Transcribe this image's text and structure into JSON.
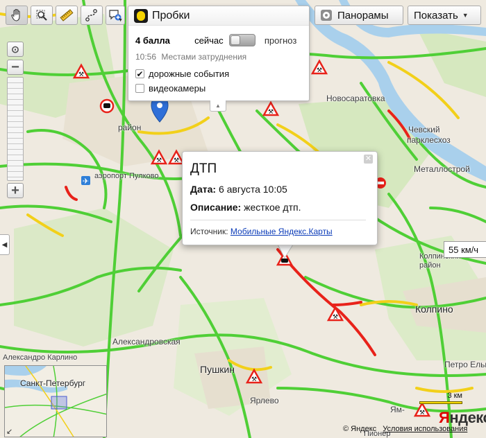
{
  "toolbar": {
    "tools": [
      {
        "name": "pan-tool",
        "icon": "hand-icon",
        "active": true
      },
      {
        "name": "magnifier-tool",
        "icon": "magnifier-icon",
        "active": false
      },
      {
        "name": "ruler-tool",
        "icon": "ruler-icon",
        "active": false
      },
      {
        "name": "route-tool",
        "icon": "route-icon",
        "active": false
      },
      {
        "name": "feedback-tool",
        "icon": "speech-plus-icon",
        "active": false
      }
    ],
    "panoramas_label": "Панорамы",
    "show_label": "Показать"
  },
  "traffic": {
    "title": "Пробки",
    "score": "4 балла",
    "now_label": "сейчас",
    "forecast_label": "прогноз",
    "time": "10:56",
    "status": "Местами затруднения",
    "road_events_label": "дорожные события",
    "road_events_checked": true,
    "cameras_label": "видеокамеры",
    "cameras_checked": false
  },
  "popup": {
    "title": "ДТП",
    "date_label": "Дата:",
    "date_value": "6 августа 10:05",
    "desc_label": "Описание:",
    "desc_value": "жесткое дтп.",
    "source_label": "Источник:",
    "source_link": "Мобильные Яндекс.Карты"
  },
  "speed": "55 км/ч",
  "scale_label": "3 км",
  "logo": {
    "first": "Я",
    "rest": "ндекс"
  },
  "copyright": "© Яндекс",
  "terms": "Условия использования",
  "minimap": {
    "city": "Санкт-Петербург"
  },
  "map_labels": {
    "novosaratovka": "Новосаратовка",
    "chevsky": "Чевский",
    "parklesxoz": "парклесхоз",
    "metallostroy": "Металлострой",
    "aeroport": "аэропорт Пулково",
    "rayon": "район",
    "aleksandrovskaya": "Александровская",
    "pushkin": "Пушкин",
    "kolpino": "Колпино",
    "kolpinsky": "Колпинский",
    "rayon2": "район",
    "karlino": "Александро Карлино",
    "selo": "Петро Ельман",
    "yarlevo": "Ярлево",
    "ym": "Ям-",
    "pionerskiy": "Пионер"
  },
  "colors": {
    "road_green": "#4fcf36",
    "road_yellow": "#f2d01a",
    "road_red": "#e8221a",
    "water": "#a9d0ec",
    "map_bg": "#efeae0",
    "park": "#d6e8bf",
    "link": "#0b3bb8"
  }
}
